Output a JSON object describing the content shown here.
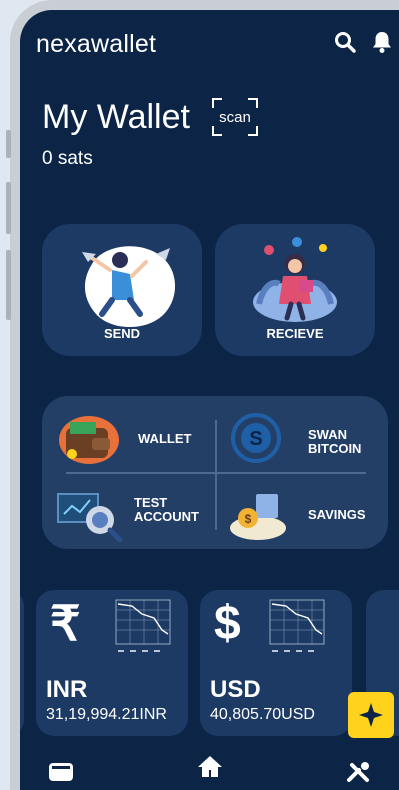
{
  "app": {
    "brand": "nexawallet"
  },
  "wallet": {
    "title": "My Wallet",
    "scan_label": "scan",
    "balance": "0 sats"
  },
  "actions": [
    {
      "label": "SEND"
    },
    {
      "label": "RECIEVE"
    }
  ],
  "features": [
    {
      "label": "WALLET"
    },
    {
      "label_line1": "SWAN",
      "label_line2": "BITCOIN"
    },
    {
      "label_line1": "TEST",
      "label_line2": "ACCOUNT"
    },
    {
      "label": "SAVINGS"
    }
  ],
  "currencies": [
    {
      "symbol": "₹",
      "code": "INR",
      "amount": "31,19,994.21INR"
    },
    {
      "symbol": "$",
      "code": "USD",
      "amount": "40,805.70USD"
    }
  ],
  "nav": {
    "items": [
      "wallet-icon",
      "home-icon",
      "tools-icon"
    ]
  },
  "colors": {
    "background": "#0c2547",
    "card": "#1c3a63",
    "accent": "#ffd21e"
  }
}
